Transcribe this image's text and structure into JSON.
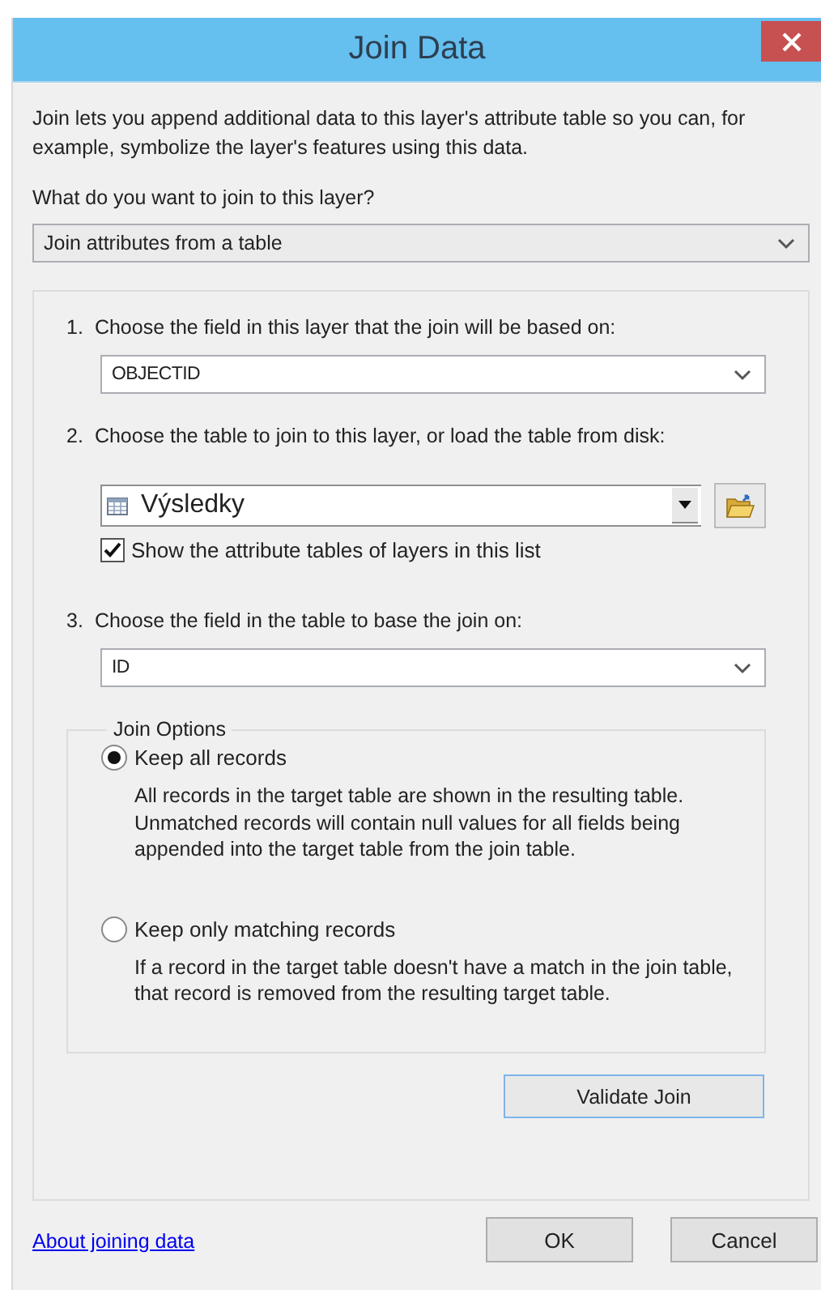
{
  "window": {
    "title": "Join Data"
  },
  "intro": "Join lets you append additional data to this layer's attribute table so you can, for example, symbolize the layer's features using this data.",
  "question": "What do you want to join to this layer?",
  "join_type": {
    "value": "Join attributes from a table"
  },
  "steps": [
    {
      "kind": "field",
      "number": "1.",
      "label": "Choose the field in this layer that the join will be based on:",
      "value": "OBJECTID"
    },
    {
      "kind": "table",
      "number": "2.",
      "label": "Choose the table to join to this layer, or load the table from disk:",
      "value": "Výsledky",
      "checkbox": {
        "label": "Show the attribute tables of layers in this list",
        "checked": true
      }
    },
    {
      "kind": "field",
      "number": "3.",
      "label": "Choose the field in the table to base the join on:",
      "value": "ID"
    }
  ],
  "join_options": {
    "title": "Join Options",
    "options": [
      {
        "label": "Keep all records",
        "description": "All records in the target table are shown in the resulting table. Unmatched records will contain null values for all fields being appended into the target table from the join table.",
        "selected": true
      },
      {
        "label": "Keep only matching records",
        "description": "If a record in the target table doesn't have a match in the join table, that record is removed from the resulting target table.",
        "selected": false
      }
    ]
  },
  "validate_button": "Validate Join",
  "help_link": "About joining data",
  "buttons": [
    "OK",
    "Cancel"
  ]
}
